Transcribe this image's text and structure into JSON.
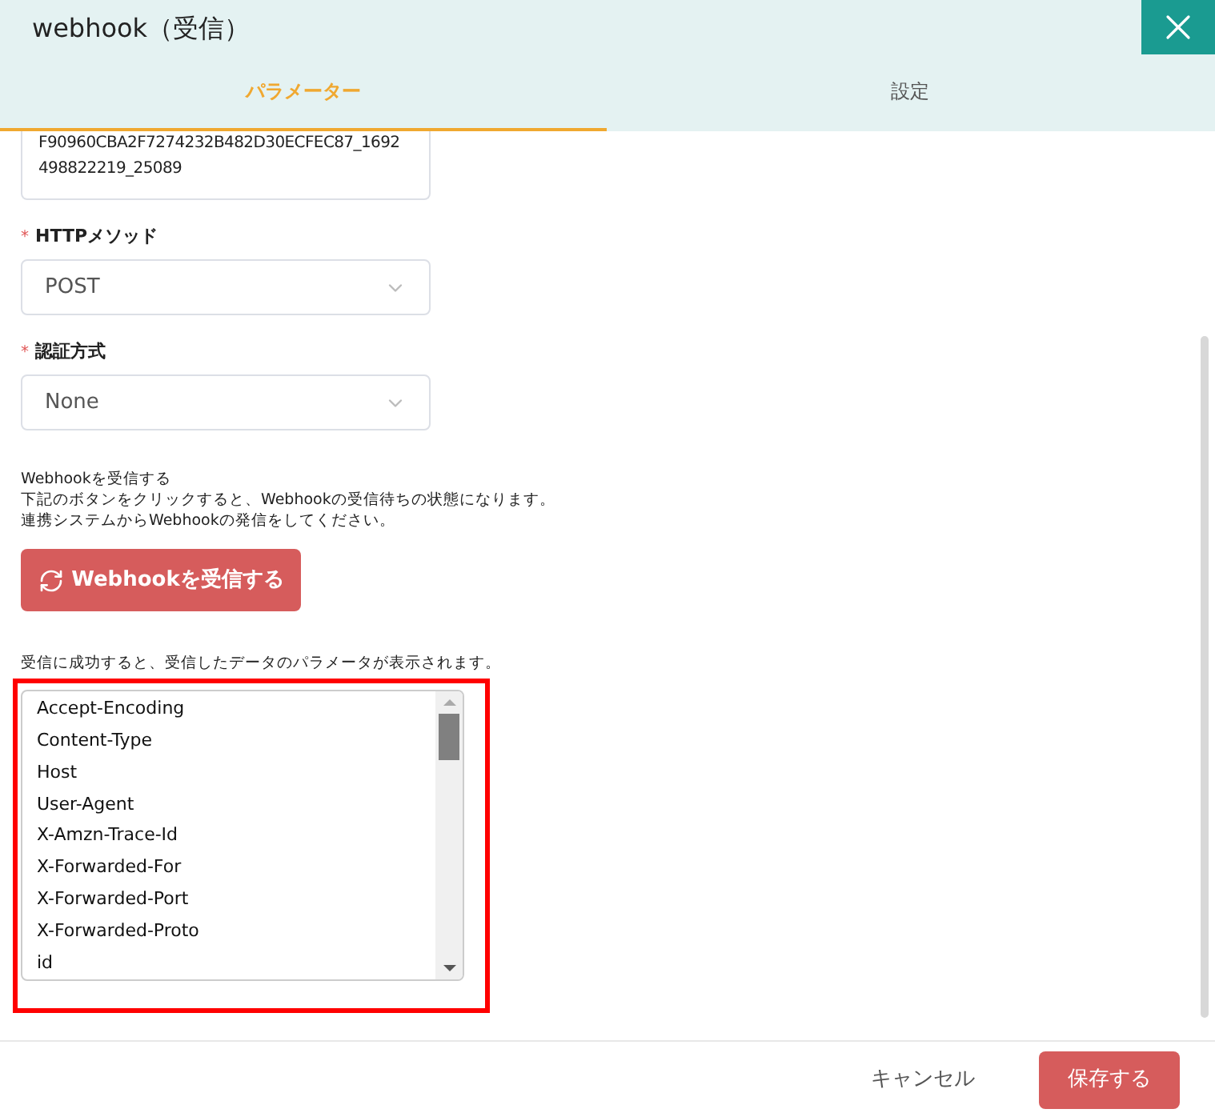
{
  "window": {
    "title": "webhook（受信）"
  },
  "tabs": [
    {
      "label": "パラメーター",
      "selected": true
    },
    {
      "label": "設定",
      "selected": false
    }
  ],
  "id_field": {
    "lines": [
      "F90960CBA2F7274232B482D30ECFEC87_1692",
      "498822219_25089"
    ]
  },
  "fields": [
    {
      "required_mark": "*",
      "label": "HTTPメソッド",
      "value": "POST"
    },
    {
      "required_mark": "*",
      "label": "認証方式",
      "value": "None"
    }
  ],
  "receive_section": {
    "heading": "Webhookを受信する",
    "lines": [
      "下記のボタンをクリックすると、Webhookの受信待ちの状態になります。",
      "連携システムからWebhookの発信をしてください。"
    ],
    "button": "Webhookを受信する"
  },
  "result_note": "受信に成功すると、受信したデータのパラメータが表示されます。",
  "parameters": [
    "Accept-Encoding",
    "Content-Type",
    "Host",
    "User-Agent",
    "X-Amzn-Trace-Id",
    "X-Forwarded-For",
    "X-Forwarded-Port",
    "X-Forwarded-Proto",
    "id"
  ],
  "footer": {
    "cancel": "キャンセル",
    "save": "保存する"
  }
}
